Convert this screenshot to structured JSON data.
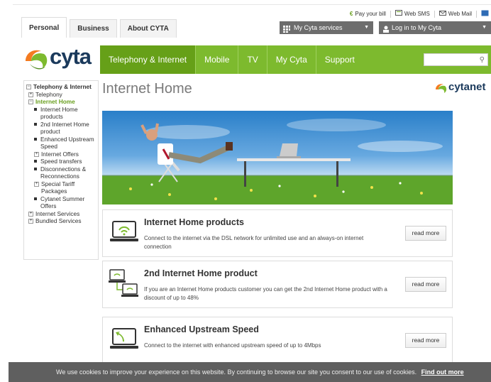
{
  "top": {
    "tabs": [
      "Personal",
      "Business",
      "About CYTA"
    ],
    "utility": [
      "Pay your bill",
      "Web SMS",
      "Web Mail"
    ],
    "my_cyta_services": "My Cyta services",
    "login": "Log in to My Cyta"
  },
  "logo": "cyta",
  "nav": [
    "Telephony & Internet",
    "Mobile",
    "TV",
    "My Cyta",
    "Support"
  ],
  "search": {
    "placeholder": ""
  },
  "sidebar": {
    "items": [
      {
        "label": "Telephony & Internet",
        "marker": "minus",
        "level": 0,
        "style": "bold"
      },
      {
        "label": "Telephony",
        "marker": "plus",
        "level": 1,
        "style": "normal"
      },
      {
        "label": "Internet Home",
        "marker": "minus",
        "level": 1,
        "style": "green"
      },
      {
        "label": "Internet Home products",
        "marker": "bullet",
        "level": 2,
        "style": "normal"
      },
      {
        "label": "2nd Internet Home product",
        "marker": "bullet",
        "level": 2,
        "style": "normal"
      },
      {
        "label": "Enhanced Upstream Speed",
        "marker": "bullet",
        "level": 2,
        "style": "normal"
      },
      {
        "label": "Internet Offers",
        "marker": "plus",
        "level": 2,
        "style": "normal"
      },
      {
        "label": "Speed transfers",
        "marker": "bullet",
        "level": 2,
        "style": "normal"
      },
      {
        "label": "Disconnections & Reconnections",
        "marker": "bullet",
        "level": 2,
        "style": "normal"
      },
      {
        "label": "Special Tariff Packages",
        "marker": "plus",
        "level": 2,
        "style": "normal"
      },
      {
        "label": "Cytanet Summer Offers",
        "marker": "bullet",
        "level": 2,
        "style": "normal"
      },
      {
        "label": "Internet Services",
        "marker": "plus",
        "level": 1,
        "style": "normal"
      },
      {
        "label": "Bundled Services",
        "marker": "plus",
        "level": 1,
        "style": "normal"
      }
    ]
  },
  "main": {
    "title": "Internet Home",
    "brand": "cytanet",
    "cards": [
      {
        "title": "Internet Home products",
        "desc": "Connect to the internet via the DSL network for unlimited use and an always-on internet connection",
        "button": "read more",
        "icon": "wifi-laptop-icon"
      },
      {
        "title": "2nd Internet Home product",
        "desc": "If you are an Internet Home products customer you can get the 2nd Internet Home product with a discount of up to 48%",
        "button": "read more",
        "icon": "two-devices-icon"
      },
      {
        "title": "Enhanced Upstream Speed",
        "desc": "Connect to the internet with enhanced upstream speed of up to 4Mbps",
        "button": "read more",
        "icon": "upload-laptop-icon"
      }
    ]
  },
  "cookie": {
    "text": "We use cookies to improve your experience on this website. By continuing to browse our site you consent to our use of cookies.",
    "link": "Find out more"
  },
  "colors": {
    "brand_green": "#7dba2e",
    "nav_active": "#66a018",
    "navy": "#1b3a5c"
  }
}
